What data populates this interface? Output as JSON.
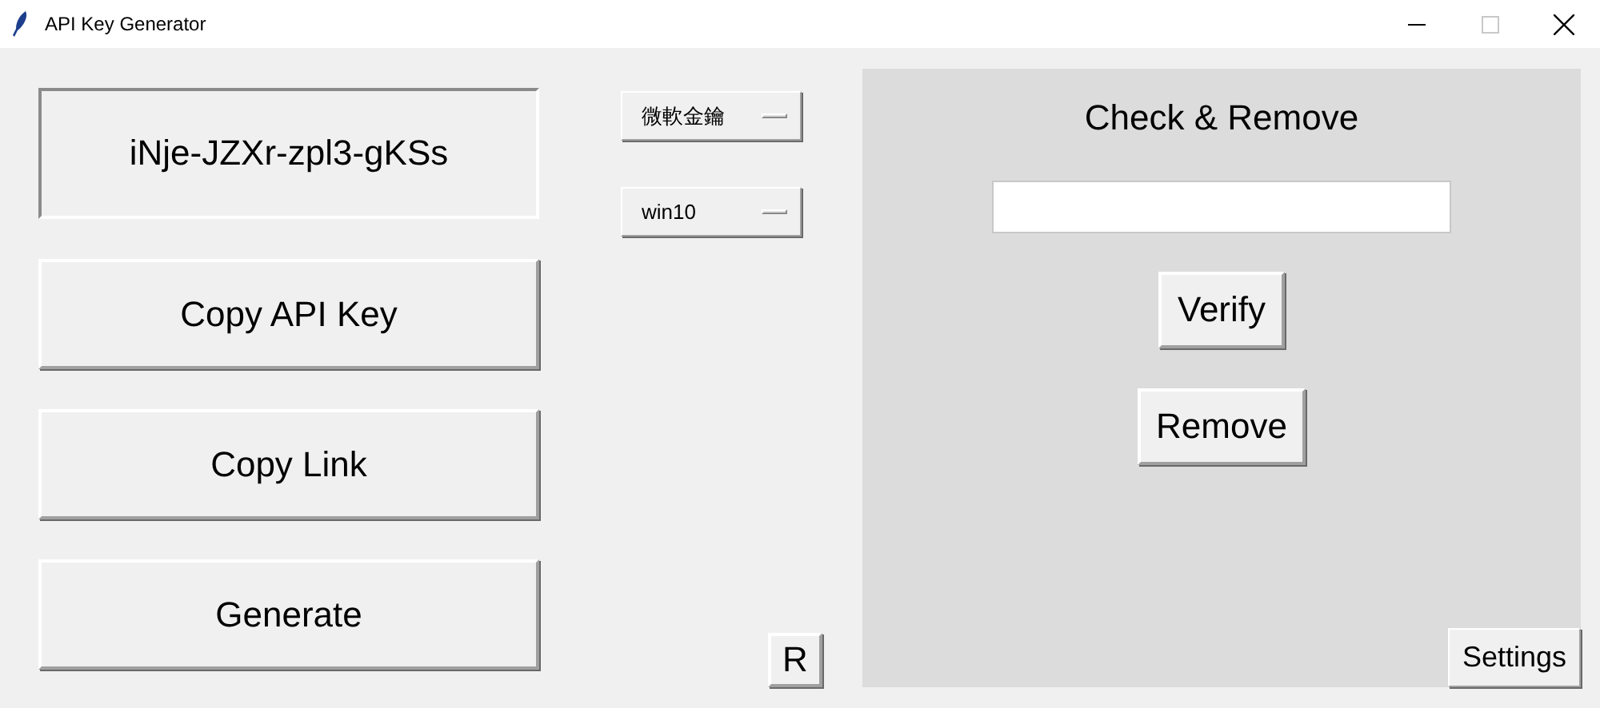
{
  "window": {
    "title": "API Key Generator",
    "controls": [
      {
        "kind": "minimize",
        "disabled": false
      },
      {
        "kind": "maximize",
        "disabled": true
      },
      {
        "kind": "close",
        "disabled": false
      }
    ]
  },
  "api_key": "iNje-JZXr-zpl3-gKSs",
  "left_buttons": [
    "Copy API Key",
    "Copy Link",
    "Generate"
  ],
  "dropdowns": [
    {
      "value": "微軟金鑰"
    },
    {
      "value": "win10"
    }
  ],
  "reset_button": "R",
  "panel": {
    "title": "Check & Remove",
    "buttons": [
      "Verify",
      "Remove"
    ],
    "settings_button": "Settings"
  }
}
